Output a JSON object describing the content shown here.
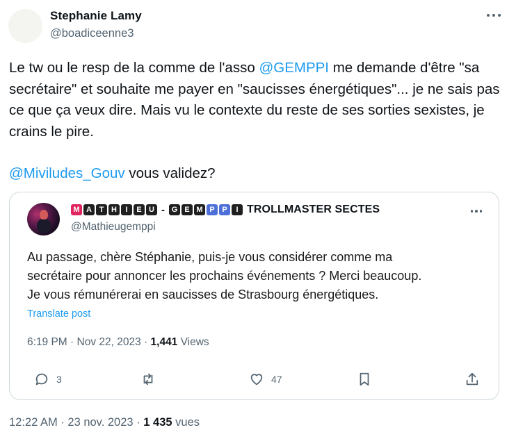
{
  "tweet": {
    "author_name": "Stephanie Lamy",
    "author_handle": "@boadiceenne3",
    "text_part1": "Le tw ou le resp de la comme de l'asso ",
    "mention1": "@GEMPPI",
    "text_part2": " me demande d'être \"sa secrétaire\" et souhaite me payer en \"saucisses énergétiques\"... je ne sais pas ce que ça veux dire. Mais vu le contexte du reste de ses sorties sexistes, je crains le pire.",
    "mention2": "@Miviludes_Gouv",
    "text_part3": " vous validez?",
    "footer_time": "12:22 AM",
    "footer_sep": " · ",
    "footer_date": "23 nov. 2023",
    "footer_sep2": " · ",
    "footer_views_count": "1 435",
    "footer_views_label": " vues"
  },
  "quoted": {
    "name_tiles_1": [
      "M",
      "A",
      "T",
      "H",
      "I",
      "E",
      "U"
    ],
    "name_dash": "-",
    "name_tiles_2": [
      "G",
      "E",
      "M",
      "P",
      "P",
      "I"
    ],
    "name_rest": "TROLLMASTER SECTES",
    "handle": "@Mathieugemppi",
    "line1": "Au passage, chère Stéphanie, puis-je vous considérer comme ma",
    "line2": "secrétaire pour annoncer les prochains événements ? Merci beaucoup.",
    "line3": "Je vous rémunérerai en saucisses de Strasbourg énergétiques.",
    "translate": "Translate post",
    "time": "6:19 PM",
    "sep": " · ",
    "date": "Nov 22, 2023",
    "sep2": " · ",
    "views_count": "1,441",
    "views_label": " Views",
    "reply_count": "3",
    "like_count": "47"
  },
  "icons": {
    "more": "more-horizontal-icon",
    "reply": "reply-bubble-icon",
    "retweet": "retweet-icon",
    "like": "heart-icon",
    "bookmark": "bookmark-icon",
    "share": "share-upload-icon"
  },
  "colors": {
    "link": "#1d9bf0",
    "secondary_text": "#536471",
    "border": "#cfd9de"
  }
}
